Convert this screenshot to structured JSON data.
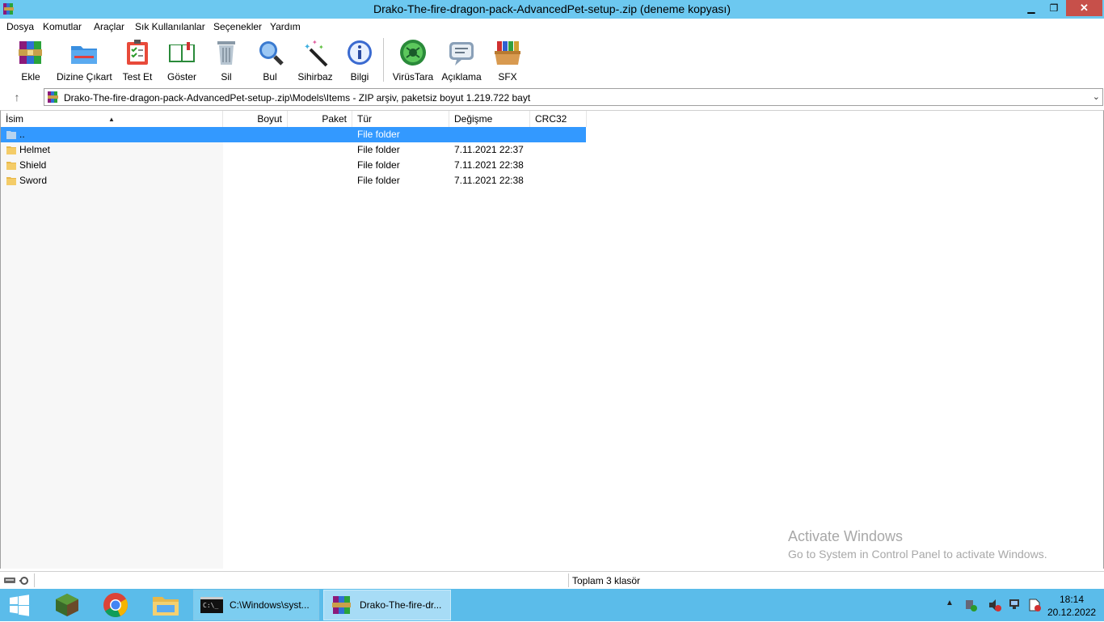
{
  "window": {
    "title": "Drako-The-fire-dragon-pack-AdvancedPet-setup-.zip (deneme kopyası)",
    "min_glyph": "▁",
    "max_glyph": "❐",
    "close_glyph": "✕"
  },
  "menu": [
    "Dosya",
    "Komutlar",
    "Araçlar",
    "Sık Kullanılanlar",
    "Seçenekler",
    "Yardım"
  ],
  "toolbar": [
    {
      "label": "Ekle",
      "icon": "archive-add-icon"
    },
    {
      "label": "Dizine Çıkart",
      "icon": "extract-folder-icon"
    },
    {
      "label": "Test Et",
      "icon": "test-checklist-icon"
    },
    {
      "label": "Göster",
      "icon": "view-book-icon"
    },
    {
      "label": "Sil",
      "icon": "trash-can-icon"
    },
    {
      "label": "Bul",
      "icon": "find-magnifier-icon"
    },
    {
      "label": "Sihirbaz",
      "icon": "wizard-wand-icon"
    },
    {
      "label": "Bilgi",
      "icon": "info-icon"
    },
    {
      "label": "VirüsTara",
      "icon": "virus-scan-icon"
    },
    {
      "label": "Açıklama",
      "icon": "comment-icon"
    },
    {
      "label": "SFX",
      "icon": "sfx-box-icon"
    }
  ],
  "address": {
    "path": "Drako-The-fire-dragon-pack-AdvancedPet-setup-.zip\\Models\\Items - ZIP arşiv, paketsiz boyut 1.219.722 bayt",
    "up_glyph": "↑",
    "dropdown_glyph": "⌄"
  },
  "columns": {
    "name": "İsim",
    "size": "Boyut",
    "packed": "Paket",
    "type": "Tür",
    "modified": "Değişme",
    "crc": "CRC32",
    "sort_glyph": "▲"
  },
  "rows": [
    {
      "name": "..",
      "type": "File folder",
      "modified": "",
      "selected": true
    },
    {
      "name": "Helmet",
      "type": "File folder",
      "modified": "7.11.2021 22:37",
      "selected": false
    },
    {
      "name": "Shield",
      "type": "File folder",
      "modified": "7.11.2021 22:38",
      "selected": false
    },
    {
      "name": "Sword",
      "type": "File folder",
      "modified": "7.11.2021 22:38",
      "selected": false
    }
  ],
  "watermark": {
    "line1": "Activate Windows",
    "line2": "Go to System in Control Panel to activate Windows."
  },
  "status": {
    "summary": "Toplam 3 klasör"
  },
  "taskbar": {
    "items": [
      {
        "text": "C:\\Windows\\syst...",
        "icon": "cmd-icon",
        "active": false
      },
      {
        "text": "Drako-The-fire-dr...",
        "icon": "winrar-icon",
        "active": true
      }
    ],
    "tray_arrow": "▲",
    "time": "18:14",
    "date": "20.12.2022"
  }
}
